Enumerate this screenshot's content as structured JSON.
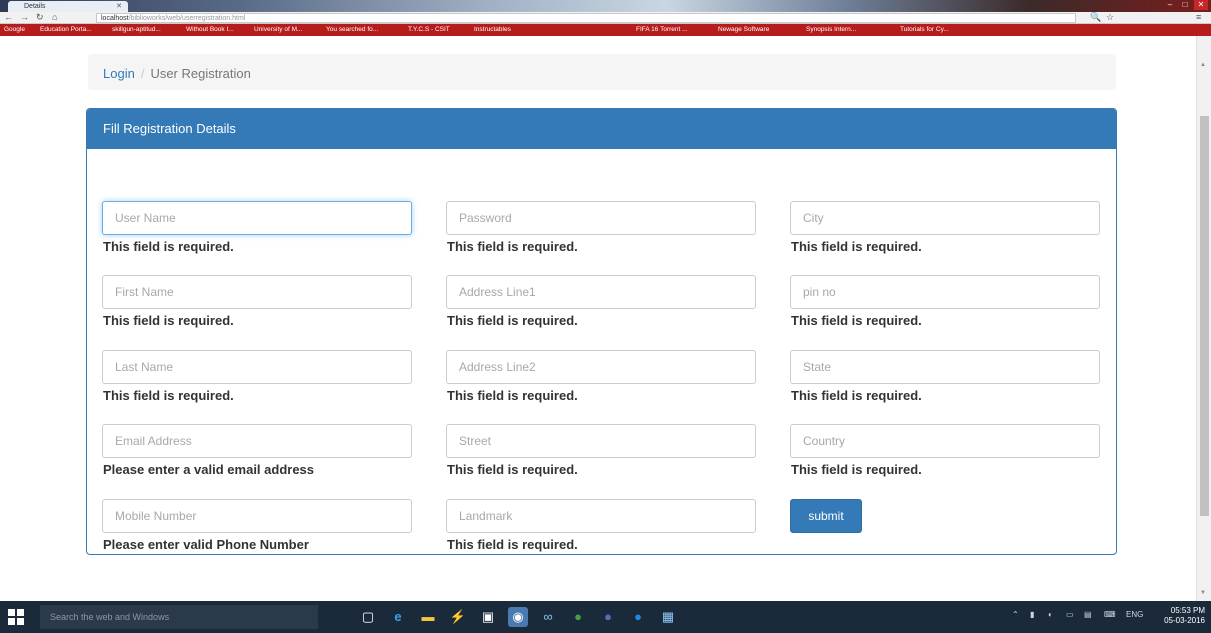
{
  "browser": {
    "tab_title": "Details",
    "url_host": "localhost",
    "url_path": "/biblioworks/web/userregistration.html",
    "bookmarks": [
      "Google",
      "Education Porta...",
      "skillgun-aptitud...",
      "Without Book I...",
      "University of M...",
      "You searched fo...",
      "T.Y.C.S - CSIT",
      "Instructables",
      "FIFA 16 Torrent ...",
      "Newage Software",
      "Synopsis Intern...",
      "Tutorials for Cy..."
    ]
  },
  "breadcrumb": {
    "login": "Login",
    "separator": "/",
    "current": "User Registration"
  },
  "panel": {
    "heading": "Fill Registration Details"
  },
  "form": {
    "col1": [
      {
        "placeholder": "User Name",
        "value": "",
        "error": "This field is required."
      },
      {
        "placeholder": "First Name",
        "value": "",
        "error": "This field is required."
      },
      {
        "placeholder": "Last Name",
        "value": "",
        "error": "This field is required."
      },
      {
        "placeholder": "Email Address",
        "value": "",
        "error": "Please enter a valid email address"
      },
      {
        "placeholder": "Mobile Number",
        "value": "",
        "error": "Please enter valid Phone Number"
      }
    ],
    "col2": [
      {
        "placeholder": "Password",
        "value": "",
        "error": "This field is required."
      },
      {
        "placeholder": "Address Line1",
        "value": "",
        "error": "This field is required."
      },
      {
        "placeholder": "Address Line2",
        "value": "",
        "error": "This field is required."
      },
      {
        "placeholder": "Street",
        "value": "",
        "error": "This field is required."
      },
      {
        "placeholder": "Landmark",
        "value": "",
        "error": "This field is required."
      }
    ],
    "col3": [
      {
        "placeholder": "City",
        "value": "",
        "error": "This field is required."
      },
      {
        "placeholder": "pin no",
        "value": "",
        "error": "This field is required."
      },
      {
        "placeholder": "State",
        "value": "",
        "error": "This field is required."
      },
      {
        "placeholder": "Country",
        "value": "",
        "error": "This field is required."
      }
    ],
    "submit_label": "submit"
  },
  "taskbar": {
    "search_placeholder": "Search the web and Windows",
    "language": "ENG",
    "time": "05:53 PM",
    "date": "05-03-2016"
  },
  "colors": {
    "primary": "#337ab7",
    "bookmark_bar": "#b71c1c"
  }
}
